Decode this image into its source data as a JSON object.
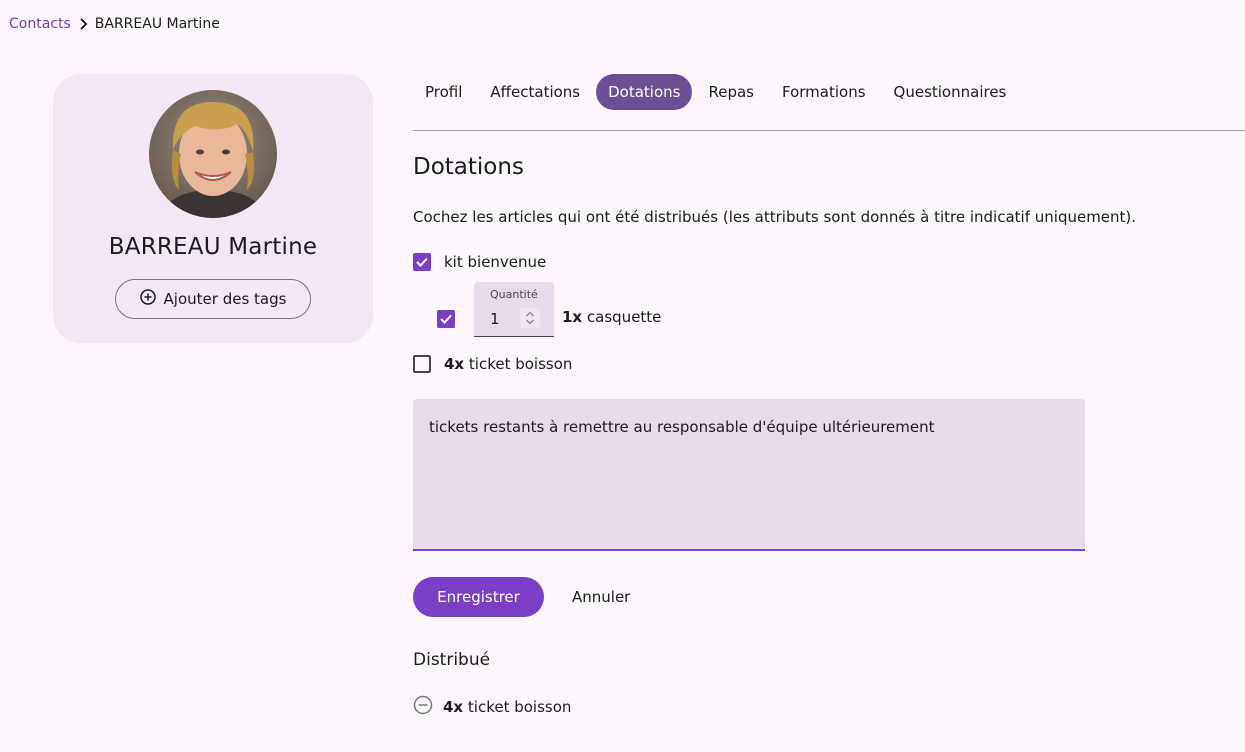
{
  "breadcrumb": {
    "parent": "Contacts",
    "current": "BARREAU Martine"
  },
  "profile": {
    "name": "BARREAU Martine",
    "add_tags_label": "Ajouter des tags"
  },
  "tabs": [
    {
      "label": "Profil",
      "active": false
    },
    {
      "label": "Affectations",
      "active": false
    },
    {
      "label": "Dotations",
      "active": true
    },
    {
      "label": "Repas",
      "active": false
    },
    {
      "label": "Formations",
      "active": false
    },
    {
      "label": "Questionnaires",
      "active": false
    }
  ],
  "section": {
    "title": "Dotations",
    "intro": "Cochez les articles qui ont été distribués (les attributs sont donnés à titre indicatif uniquement).",
    "kit": {
      "label": "kit bienvenue",
      "checked": true
    },
    "casquette": {
      "checked": true,
      "quantity_label": "Quantité",
      "quantity_value": "1",
      "count": "1x",
      "label": "casquette"
    },
    "ticket": {
      "checked": false,
      "count": "4x",
      "label": "ticket boisson"
    },
    "notes": "tickets restants à remettre au responsable d'équipe ultérieurement",
    "save_label": "Enregistrer",
    "cancel_label": "Annuler"
  },
  "distributed": {
    "title": "Distribué",
    "items": [
      {
        "count": "4x",
        "label": "ticket boisson"
      }
    ]
  },
  "colors": {
    "primary": "#7a3fc4",
    "active_tab": "#6b4f94",
    "background": "#fdf7fd",
    "card": "#f1e8f3",
    "field": "#e6dce9"
  }
}
